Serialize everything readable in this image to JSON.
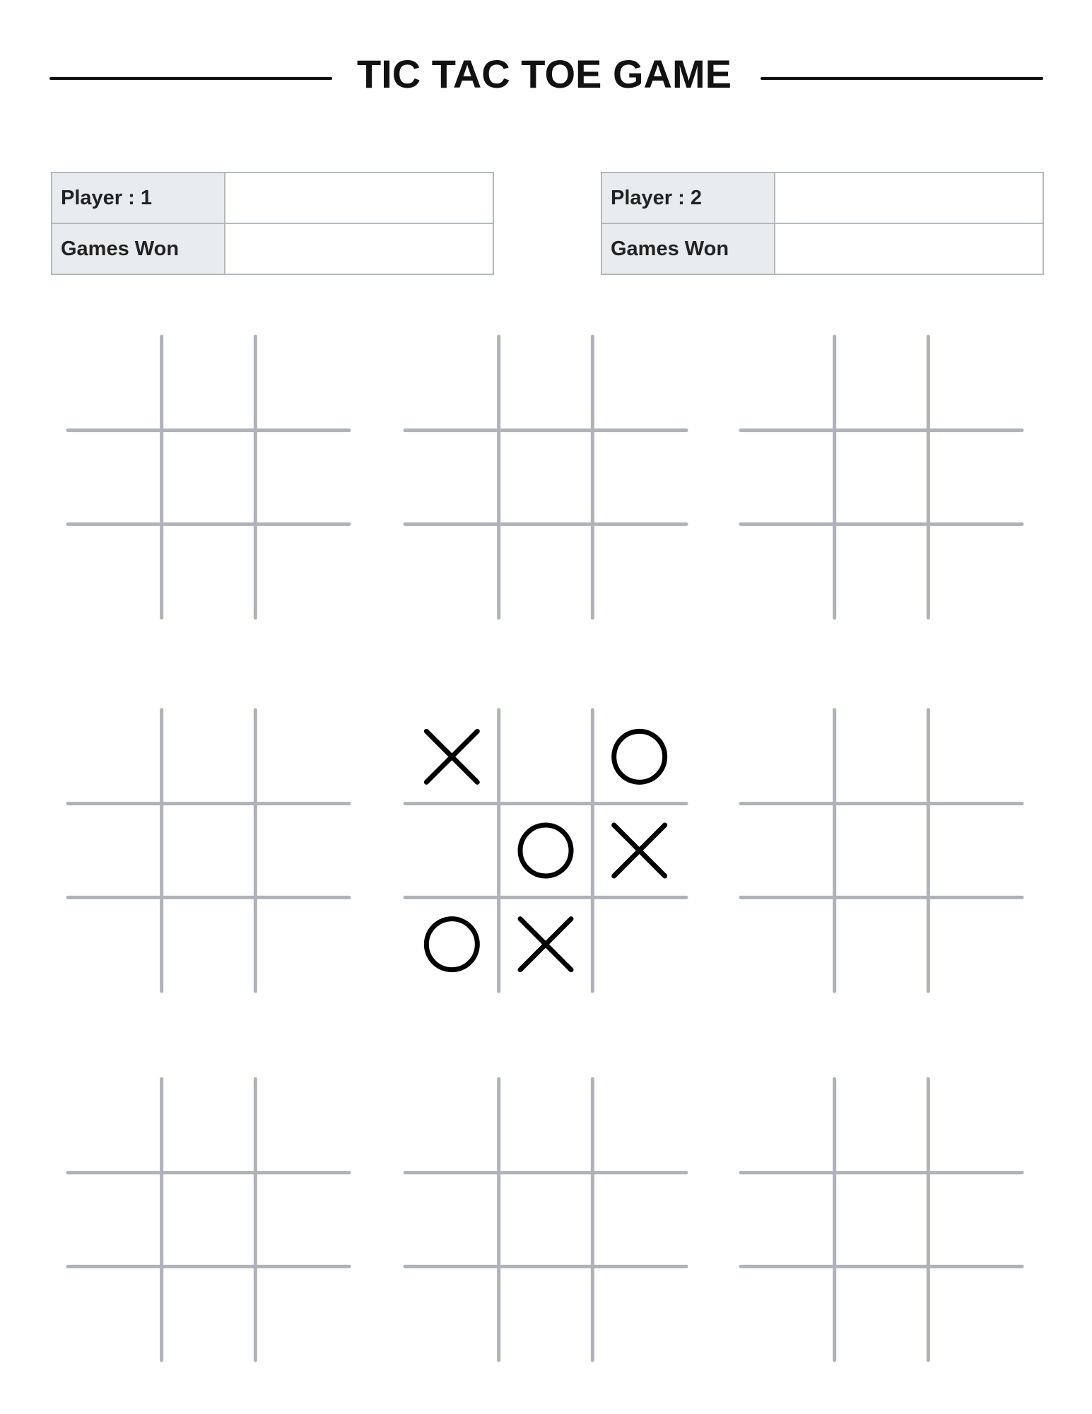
{
  "title": "TIC TAC TOE GAME",
  "players": [
    {
      "player_label": "Player : 1",
      "games_won_label": "Games Won",
      "name_value": "",
      "games_won_value": ""
    },
    {
      "player_label": "Player : 2",
      "games_won_label": "Games Won",
      "name_value": "",
      "games_won_value": ""
    }
  ],
  "colors": {
    "grid": "#aeb3ba",
    "marks": "#000000",
    "label_bg": "#e9ecef"
  },
  "boards": [
    [
      "",
      "",
      "",
      "",
      "",
      "",
      "",
      "",
      ""
    ],
    [
      "",
      "",
      "",
      "",
      "",
      "",
      "",
      "",
      ""
    ],
    [
      "",
      "",
      "",
      "",
      "",
      "",
      "",
      "",
      ""
    ],
    [
      "",
      "",
      "",
      "",
      "",
      "",
      "",
      "",
      ""
    ],
    [
      "X",
      "",
      "O",
      "",
      "O",
      "X",
      "O",
      "X",
      ""
    ],
    [
      "",
      "",
      "",
      "",
      "",
      "",
      "",
      "",
      ""
    ],
    [
      "",
      "",
      "",
      "",
      "",
      "",
      "",
      "",
      ""
    ],
    [
      "",
      "",
      "",
      "",
      "",
      "",
      "",
      "",
      ""
    ],
    [
      "",
      "",
      "",
      "",
      "",
      "",
      "",
      "",
      ""
    ]
  ]
}
